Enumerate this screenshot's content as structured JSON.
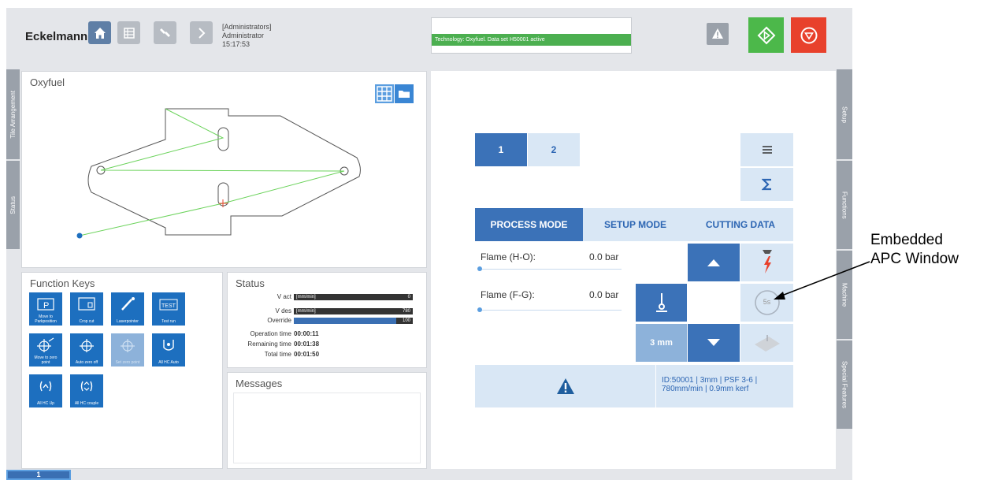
{
  "header": {
    "logo": "Eckelmann",
    "user_role": "[Administrators]",
    "user_name": "Administrator",
    "time": "15:17:53",
    "status_message": "Technology: Oxyfuel. Data set H50001 active"
  },
  "side_tabs": {
    "left": [
      "Tile Arrangement",
      "Status"
    ],
    "right": [
      "Setup",
      "Functions",
      "Machine",
      "Special Features"
    ]
  },
  "oxyfuel": {
    "title": "Oxyfuel"
  },
  "function_keys": {
    "title": "Function Keys",
    "keys": [
      {
        "label": "Move to Parkposition",
        "icon": "park-icon"
      },
      {
        "label": "Crop cut",
        "icon": "crop-cut-icon"
      },
      {
        "label": "Laserpointer",
        "icon": "laser-pointer-icon"
      },
      {
        "label": "Test run",
        "icon": "test-run-icon"
      },
      {
        "label": "Move to zero point",
        "icon": "zero-point-icon"
      },
      {
        "label": "Auto zero off",
        "icon": "auto-zero-icon"
      },
      {
        "label": "Set zero point",
        "icon": "set-zero-icon"
      },
      {
        "label": "All HC Auto",
        "icon": "hc-auto-icon"
      },
      {
        "label": "All HC Up",
        "icon": "hc-up-icon"
      },
      {
        "label": "All HC couple",
        "icon": "hc-couple-icon"
      }
    ]
  },
  "status": {
    "title": "Status",
    "v_act": {
      "label": "V act",
      "unit": "[mm/min]",
      "value": "0"
    },
    "v_des": {
      "label": "V des",
      "unit": "[mm/min]",
      "value": "780"
    },
    "override": {
      "label": "Override",
      "value": "100",
      "fill": 0.86
    },
    "operation_time": {
      "label": "Operation time",
      "value": "00:00:11"
    },
    "remaining_time": {
      "label": "Remaining time",
      "value": "00:01:38"
    },
    "total_time": {
      "label": "Total time",
      "value": "00:01:50"
    }
  },
  "messages": {
    "title": "Messages"
  },
  "apc": {
    "page_tabs": [
      "1",
      "2"
    ],
    "mode_tabs": [
      "PROCESS MODE",
      "SETUP MODE",
      "CUTTING DATA"
    ],
    "flame_ho": {
      "label": "Flame (H-O):",
      "value": "0.0 bar"
    },
    "flame_fg": {
      "label": "Flame (F-G):",
      "value": "0.0 bar"
    },
    "height_value": "3 mm",
    "timer": "5s",
    "info": "ID:50001 | 3mm | PSF 3-6 | 780mm/min | 0.9mm kerf"
  },
  "annotation": {
    "line1": "Embedded",
    "line2": "APC Window"
  },
  "bottom_tab": "1",
  "colors": {
    "accent": "#1d6fbf",
    "apc_blue": "#3b72b8",
    "apc_light": "#d9e7f5",
    "green": "#4cb84a",
    "red": "#e8412c"
  }
}
